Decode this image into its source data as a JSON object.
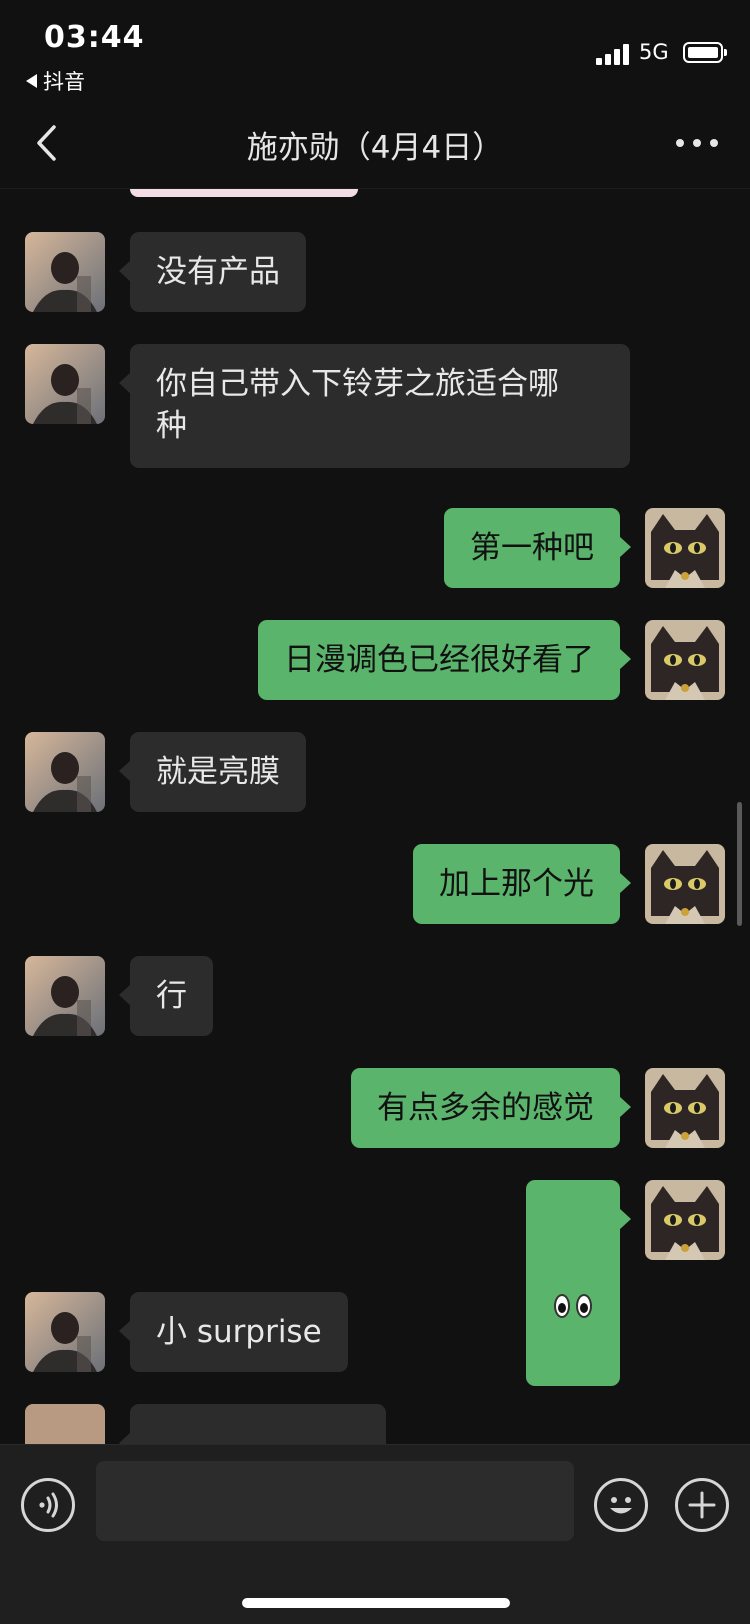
{
  "status_bar": {
    "time": "03:44",
    "back_app": "抖音",
    "network": "5G",
    "battery_level": 1.0
  },
  "nav": {
    "title": "施亦勋（4月4日）",
    "back_icon": "chevron-left-icon",
    "more_icon": "more-dots-icon"
  },
  "messages": [
    {
      "side": "in",
      "text": "没有产品"
    },
    {
      "side": "in",
      "text": "你自己带入下铃芽之旅适合哪\n种"
    },
    {
      "side": "out",
      "text": "第一种吧"
    },
    {
      "side": "out",
      "text": "日漫调色已经很好看了"
    },
    {
      "side": "in",
      "text": "就是亮膜"
    },
    {
      "side": "out",
      "text": "加上那个光"
    },
    {
      "side": "in",
      "text": "行"
    },
    {
      "side": "out",
      "text": "有点多余的感觉"
    },
    {
      "side": "out",
      "text": "👀",
      "icon": "eyes-emoji-icon"
    },
    {
      "side": "in",
      "text": "小 surprise"
    }
  ],
  "input_bar": {
    "voice_icon": "voice-icon",
    "emoji_icon": "emoji-icon",
    "plus_icon": "plus-icon",
    "input_value": ""
  },
  "colors": {
    "background": "#111111",
    "incoming_bubble": "#2c2c2c",
    "outgoing_bubble": "#5ab46c"
  }
}
